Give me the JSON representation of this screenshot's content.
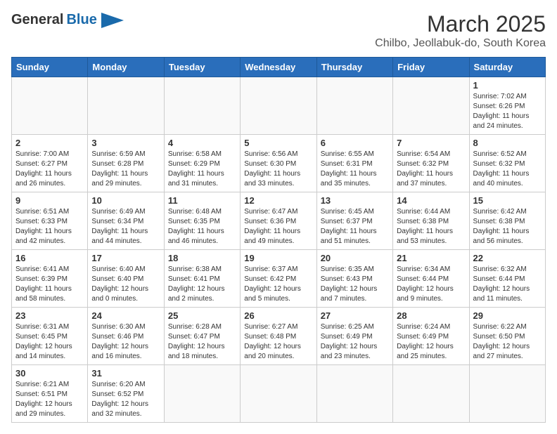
{
  "header": {
    "logo_general": "General",
    "logo_blue": "Blue",
    "title": "March 2025",
    "subtitle": "Chilbo, Jeollabuk-do, South Korea"
  },
  "calendar": {
    "days_of_week": [
      "Sunday",
      "Monday",
      "Tuesday",
      "Wednesday",
      "Thursday",
      "Friday",
      "Saturday"
    ],
    "weeks": [
      [
        {
          "day": "",
          "info": ""
        },
        {
          "day": "",
          "info": ""
        },
        {
          "day": "",
          "info": ""
        },
        {
          "day": "",
          "info": ""
        },
        {
          "day": "",
          "info": ""
        },
        {
          "day": "",
          "info": ""
        },
        {
          "day": "1",
          "info": "Sunrise: 7:02 AM\nSunset: 6:26 PM\nDaylight: 11 hours and 24 minutes."
        }
      ],
      [
        {
          "day": "2",
          "info": "Sunrise: 7:00 AM\nSunset: 6:27 PM\nDaylight: 11 hours and 26 minutes."
        },
        {
          "day": "3",
          "info": "Sunrise: 6:59 AM\nSunset: 6:28 PM\nDaylight: 11 hours and 29 minutes."
        },
        {
          "day": "4",
          "info": "Sunrise: 6:58 AM\nSunset: 6:29 PM\nDaylight: 11 hours and 31 minutes."
        },
        {
          "day": "5",
          "info": "Sunrise: 6:56 AM\nSunset: 6:30 PM\nDaylight: 11 hours and 33 minutes."
        },
        {
          "day": "6",
          "info": "Sunrise: 6:55 AM\nSunset: 6:31 PM\nDaylight: 11 hours and 35 minutes."
        },
        {
          "day": "7",
          "info": "Sunrise: 6:54 AM\nSunset: 6:32 PM\nDaylight: 11 hours and 37 minutes."
        },
        {
          "day": "8",
          "info": "Sunrise: 6:52 AM\nSunset: 6:32 PM\nDaylight: 11 hours and 40 minutes."
        }
      ],
      [
        {
          "day": "9",
          "info": "Sunrise: 6:51 AM\nSunset: 6:33 PM\nDaylight: 11 hours and 42 minutes."
        },
        {
          "day": "10",
          "info": "Sunrise: 6:49 AM\nSunset: 6:34 PM\nDaylight: 11 hours and 44 minutes."
        },
        {
          "day": "11",
          "info": "Sunrise: 6:48 AM\nSunset: 6:35 PM\nDaylight: 11 hours and 46 minutes."
        },
        {
          "day": "12",
          "info": "Sunrise: 6:47 AM\nSunset: 6:36 PM\nDaylight: 11 hours and 49 minutes."
        },
        {
          "day": "13",
          "info": "Sunrise: 6:45 AM\nSunset: 6:37 PM\nDaylight: 11 hours and 51 minutes."
        },
        {
          "day": "14",
          "info": "Sunrise: 6:44 AM\nSunset: 6:38 PM\nDaylight: 11 hours and 53 minutes."
        },
        {
          "day": "15",
          "info": "Sunrise: 6:42 AM\nSunset: 6:38 PM\nDaylight: 11 hours and 56 minutes."
        }
      ],
      [
        {
          "day": "16",
          "info": "Sunrise: 6:41 AM\nSunset: 6:39 PM\nDaylight: 11 hours and 58 minutes."
        },
        {
          "day": "17",
          "info": "Sunrise: 6:40 AM\nSunset: 6:40 PM\nDaylight: 12 hours and 0 minutes."
        },
        {
          "day": "18",
          "info": "Sunrise: 6:38 AM\nSunset: 6:41 PM\nDaylight: 12 hours and 2 minutes."
        },
        {
          "day": "19",
          "info": "Sunrise: 6:37 AM\nSunset: 6:42 PM\nDaylight: 12 hours and 5 minutes."
        },
        {
          "day": "20",
          "info": "Sunrise: 6:35 AM\nSunset: 6:43 PM\nDaylight: 12 hours and 7 minutes."
        },
        {
          "day": "21",
          "info": "Sunrise: 6:34 AM\nSunset: 6:44 PM\nDaylight: 12 hours and 9 minutes."
        },
        {
          "day": "22",
          "info": "Sunrise: 6:32 AM\nSunset: 6:44 PM\nDaylight: 12 hours and 11 minutes."
        }
      ],
      [
        {
          "day": "23",
          "info": "Sunrise: 6:31 AM\nSunset: 6:45 PM\nDaylight: 12 hours and 14 minutes."
        },
        {
          "day": "24",
          "info": "Sunrise: 6:30 AM\nSunset: 6:46 PM\nDaylight: 12 hours and 16 minutes."
        },
        {
          "day": "25",
          "info": "Sunrise: 6:28 AM\nSunset: 6:47 PM\nDaylight: 12 hours and 18 minutes."
        },
        {
          "day": "26",
          "info": "Sunrise: 6:27 AM\nSunset: 6:48 PM\nDaylight: 12 hours and 20 minutes."
        },
        {
          "day": "27",
          "info": "Sunrise: 6:25 AM\nSunset: 6:49 PM\nDaylight: 12 hours and 23 minutes."
        },
        {
          "day": "28",
          "info": "Sunrise: 6:24 AM\nSunset: 6:49 PM\nDaylight: 12 hours and 25 minutes."
        },
        {
          "day": "29",
          "info": "Sunrise: 6:22 AM\nSunset: 6:50 PM\nDaylight: 12 hours and 27 minutes."
        }
      ],
      [
        {
          "day": "30",
          "info": "Sunrise: 6:21 AM\nSunset: 6:51 PM\nDaylight: 12 hours and 29 minutes."
        },
        {
          "day": "31",
          "info": "Sunrise: 6:20 AM\nSunset: 6:52 PM\nDaylight: 12 hours and 32 minutes."
        },
        {
          "day": "",
          "info": ""
        },
        {
          "day": "",
          "info": ""
        },
        {
          "day": "",
          "info": ""
        },
        {
          "day": "",
          "info": ""
        },
        {
          "day": "",
          "info": ""
        }
      ]
    ]
  }
}
